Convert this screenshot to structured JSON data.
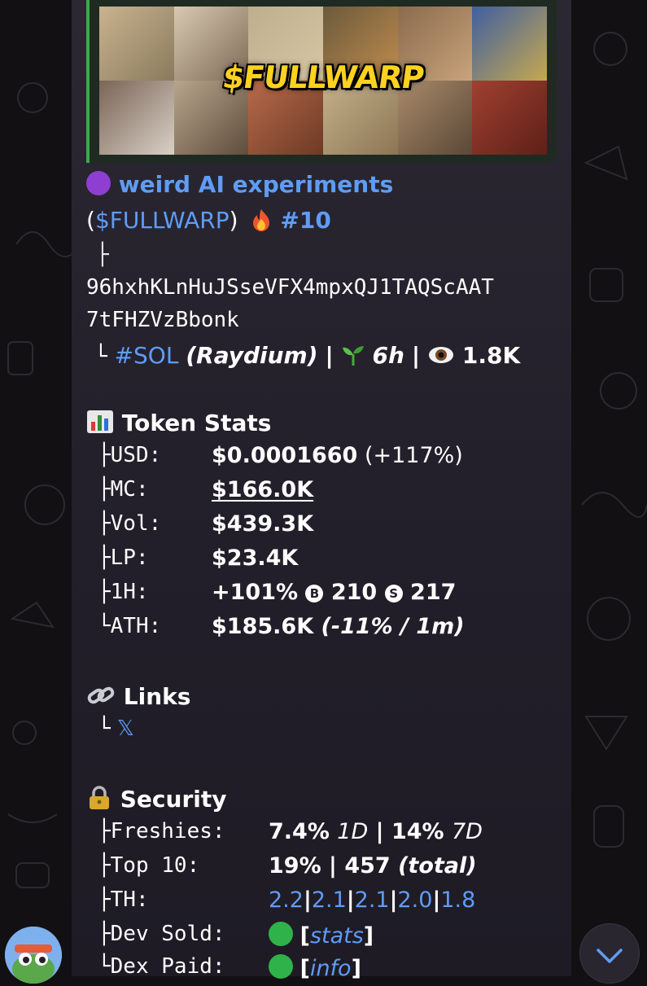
{
  "preview": {
    "brand_text": "$FULLWARP"
  },
  "message": {
    "title_dot_color": "#8e3fd1",
    "title": "weird AI experiments",
    "paren_open": "(",
    "ticker": "$FULLWARP",
    "paren_close": ")",
    "fire_icon": "fire-emoji",
    "rank": "#10",
    "tree_branch": "├",
    "tree_end": "└",
    "address_line1": "96hxhKLnHuJSseVFX4mpxQJ1TAQScAAT",
    "address_line2": "7tFHZVzBbonk",
    "chain": "#SOL",
    "dex": "(Raydium)",
    "sep": "|",
    "seedling_icon": "seedling-emoji",
    "age": "6h",
    "eye_icon": "eye-emoji",
    "views": "1.8K"
  },
  "token_stats": {
    "icon": "bar-chart-emoji",
    "heading": "Token Stats",
    "rows": [
      {
        "key": "├USD:",
        "value": "$0.0001660",
        "extra": "(+117%)"
      },
      {
        "key": "├MC:",
        "value": "$166.0K"
      },
      {
        "key": "├Vol:",
        "value": "$439.3K"
      },
      {
        "key": "├LP:",
        "value": "$23.4K"
      },
      {
        "key": "├1H:",
        "value": "+101%",
        "buy_badge": "B",
        "buys": "210",
        "sell_badge": "S",
        "sells": "217"
      },
      {
        "key": "└ATH:",
        "value": "$185.6K",
        "extra": "(-11% / 1m)"
      }
    ]
  },
  "links": {
    "icon": "link-emoji",
    "heading": "Links",
    "tree_end": "└",
    "x_link": "𝕏"
  },
  "security": {
    "icon": "lock-emoji",
    "heading": "Security",
    "freshies_key": "├Freshies:",
    "freshies_1d": "7.4%",
    "freshies_1d_label": "1D",
    "freshies_7d": "14%",
    "freshies_7d_label": "7D",
    "top10_key": "├Top 10:",
    "top10_pct": "19%",
    "top10_total": "457",
    "top10_total_label": "(total)",
    "th_key": "├TH:",
    "th_values": [
      "2.2",
      "2.1",
      "2.1",
      "2.0",
      "1.8"
    ],
    "devsold_key": "├Dev Sold:",
    "status_color": "#2fb24a",
    "devsold_link": "stats",
    "dexpaid_key": "└Dex Paid:",
    "dexpaid_link": "info",
    "bracket_open": "[",
    "bracket_close": "]"
  },
  "controls": {
    "scroll_icon": "chevron-down-icon"
  }
}
